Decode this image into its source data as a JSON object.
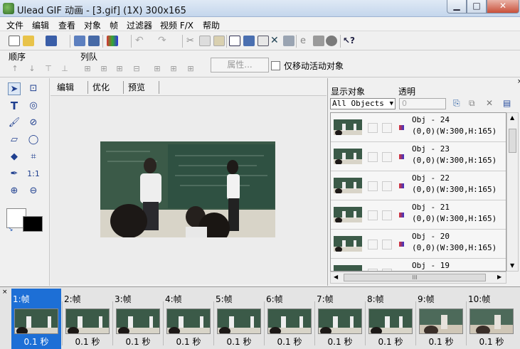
{
  "app": {
    "title": "Ulead GIF 动画 - [3.gif] (1X) 300x165"
  },
  "menu": [
    "文件",
    "编辑",
    "查看",
    "对象",
    "帧",
    "过滤器",
    "视频 F/X",
    "帮助"
  ],
  "toolbar2": {
    "order_label": "顺序",
    "queue_label": "列队",
    "attr_button": "属性...",
    "move_active_only": "仅移动活动对象"
  },
  "tabs": [
    "编辑",
    "优化",
    "预览"
  ],
  "objects_panel": {
    "display_label": "显示对象",
    "transparency_label": "透明",
    "filter_value": "All Objects",
    "transparency_value": "0",
    "items": [
      {
        "name": "Obj - 24",
        "info": "(0,0)(W:300,H:165)"
      },
      {
        "name": "Obj - 23",
        "info": "(0,0)(W:300,H:165)"
      },
      {
        "name": "Obj - 22",
        "info": "(0,0)(W:300,H:165)"
      },
      {
        "name": "Obj - 21",
        "info": "(0,0)(W:300,H:165)"
      },
      {
        "name": "Obj - 20",
        "info": "(0,0)(W:300,H:165)"
      },
      {
        "name": "Obj - 19",
        "info": ""
      }
    ],
    "scroll_thumb": "III"
  },
  "frames": [
    {
      "label": "1:帧",
      "delay": "0.1 秒"
    },
    {
      "label": "2:帧",
      "delay": "0.1 秒"
    },
    {
      "label": "3:帧",
      "delay": "0.1 秒"
    },
    {
      "label": "4:帧",
      "delay": "0.1 秒"
    },
    {
      "label": "5:帧",
      "delay": "0.1 秒"
    },
    {
      "label": "6:帧",
      "delay": "0.1 秒"
    },
    {
      "label": "7:帧",
      "delay": "0.1 秒"
    },
    {
      "label": "8:帧",
      "delay": "0.1 秒"
    },
    {
      "label": "9:帧",
      "delay": "0.1 秒"
    },
    {
      "label": "10:帧",
      "delay": "0.1 秒"
    }
  ],
  "colors": {
    "accent": "#1d6fd6",
    "foreground": "#ffffff",
    "background": "#000000"
  }
}
